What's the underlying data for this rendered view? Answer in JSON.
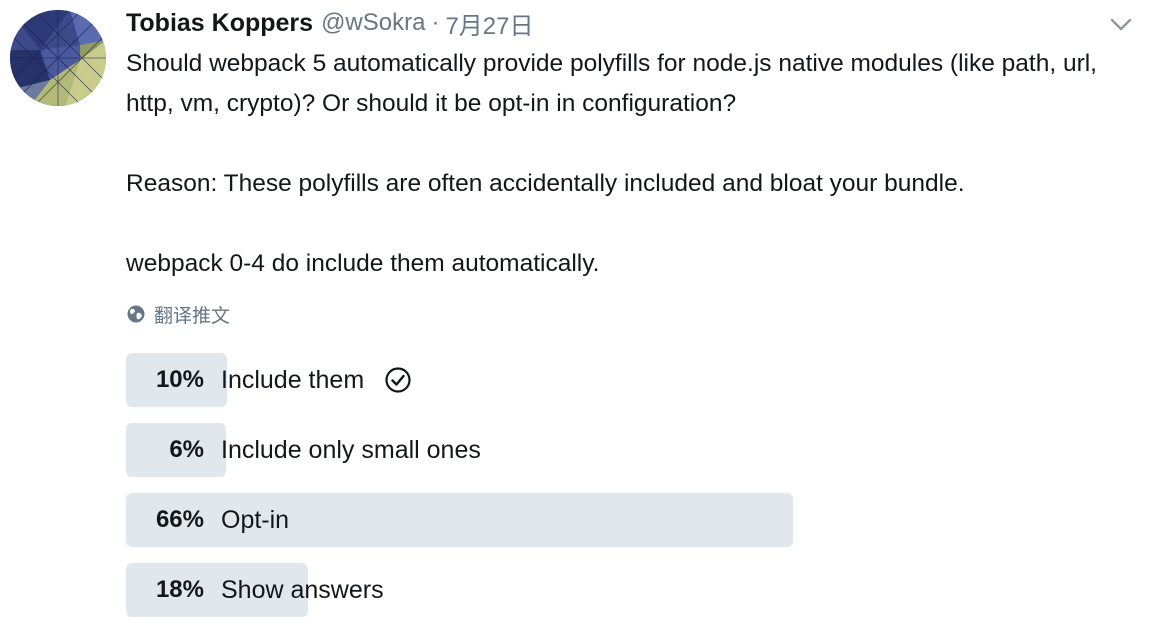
{
  "tweet": {
    "author_name": "Tobias Koppers",
    "handle": "@wSokra",
    "separator": "·",
    "date": "7月27日",
    "text": [
      "Should webpack 5 automatically provide polyfills for node.js native modules (like path, url, http, vm, crypto)? Or should it be opt-in in configuration?",
      "Reason: These polyfills are often accidentally included and bloat your bundle.",
      "webpack 0-4 do include them automatically."
    ],
    "translate_label": "翻译推文",
    "avatar_icon": "avatar-image",
    "menu_icon": "chevron-down-icon"
  },
  "poll": {
    "options": [
      {
        "percent": "10%",
        "value": 10,
        "label": "Include them",
        "selected": true
      },
      {
        "percent": "6%",
        "value": 6,
        "label": "Include only small ones",
        "selected": false
      },
      {
        "percent": "66%",
        "value": 66,
        "label": "Opt-in",
        "selected": false
      },
      {
        "percent": "18%",
        "value": 18,
        "label": "Show answers",
        "selected": false
      }
    ]
  },
  "colors": {
    "text": "#14171a",
    "secondary_text": "#657786",
    "poll_bar": "#e1e8ed"
  }
}
